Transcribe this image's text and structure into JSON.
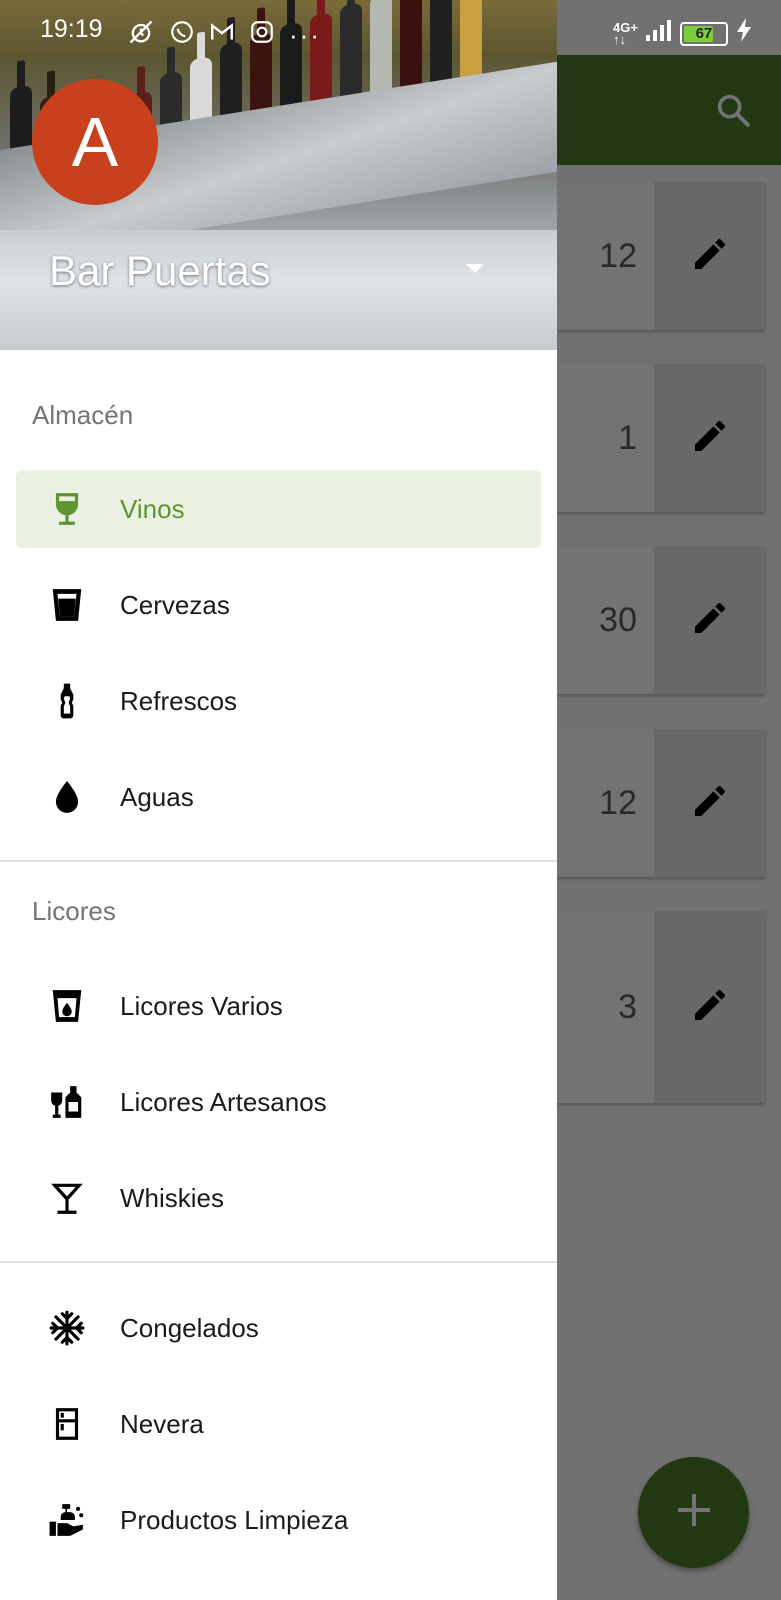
{
  "status_bar": {
    "time": "19:19",
    "network": "4G+",
    "battery": "67"
  },
  "account": {
    "avatar_letter": "A",
    "name": "Bar Puertas"
  },
  "drawer": {
    "sections": [
      {
        "title": "Almacén",
        "items": [
          {
            "label": "Vinos",
            "icon": "wine-glass-icon",
            "active": true
          },
          {
            "label": "Cervezas",
            "icon": "beer-glass-icon"
          },
          {
            "label": "Refrescos",
            "icon": "soda-bottle-icon"
          },
          {
            "label": "Aguas",
            "icon": "water-drop-icon"
          }
        ]
      },
      {
        "title": "Licores",
        "items": [
          {
            "label": "Licores Varios",
            "icon": "liquor-glass-icon"
          },
          {
            "label": "Licores Artesanos",
            "icon": "liquor-bottles-icon"
          },
          {
            "label": "Whiskies",
            "icon": "cocktail-glass-icon"
          }
        ]
      },
      {
        "title": "",
        "items": [
          {
            "label": "Congelados",
            "icon": "snowflake-icon"
          },
          {
            "label": "Nevera",
            "icon": "fridge-icon"
          },
          {
            "label": "Productos Limpieza",
            "icon": "cleaning-products-icon"
          }
        ]
      }
    ]
  },
  "background_list": {
    "quantities": [
      "12",
      "1",
      "30",
      "12",
      "3"
    ]
  },
  "colors": {
    "primary": "#4a7d2a",
    "active_text": "#5e9431",
    "active_bg": "#eaf1e2",
    "avatar": "#c8411c"
  }
}
